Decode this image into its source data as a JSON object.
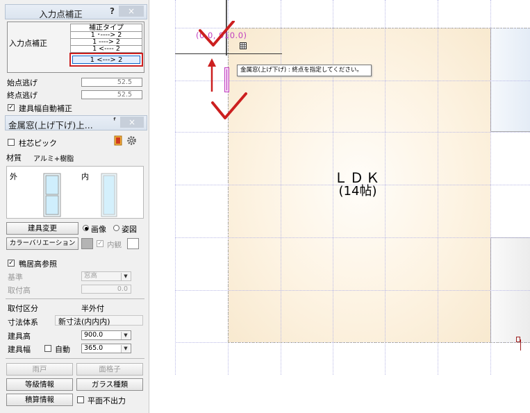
{
  "dialog_correction": {
    "title": "入力点補正",
    "help": "?",
    "close": "×",
    "table_header": "補正タイプ",
    "row_label": "入力点補正",
    "options": [
      "1 ･----> 2",
      "1 ----> 2",
      "1 <---- 2",
      "1 <---> 2"
    ],
    "start_offset_label": "始点逃げ",
    "start_offset_value": "52.5",
    "end_offset_label": "終点逃げ",
    "end_offset_value": "52.5",
    "auto_width_label": "建具幅自動補正",
    "auto_width_checked": true
  },
  "dialog_window": {
    "title": "金属窓(上げ下げ)上...",
    "pillar_pick_label": "柱芯ピック",
    "material_label": "材質",
    "material_value": "アルミ+樹脂",
    "outer_label": "外",
    "inner_label": "内",
    "change_fitting_button": "建具変更",
    "radio_image": "画像",
    "radio_figure": "姿図",
    "color_variation_button": "カラーバリエーション",
    "interior_view_label": "内観",
    "lintel_ref_label": "鴨居高参照",
    "base_label": "基準",
    "base_value": "窓高",
    "mount_height_label": "取付高",
    "mount_height_value": "0.0",
    "mount_type_label": "取付区分",
    "mount_type_value": "半外付",
    "dimension_system_label": "寸法体系",
    "dimension_system_value": "新寸法(内内内)",
    "fitting_height_label": "建具高",
    "fitting_height_value": "900.0",
    "fitting_width_label": "建具幅",
    "auto_label": "自動",
    "fitting_width_value": "365.0",
    "shutter_button": "雨戸",
    "grille_button": "面格子",
    "grade_info_button": "等級情報",
    "glass_type_button": "ガラス種類",
    "estimate_info_button": "積算情報",
    "no_plan_output_label": "平面不出力"
  },
  "canvas": {
    "coordinate_readout": "(0.0, 910.0)",
    "tooltip": "金属窓(上げ下げ) : 終点を指定してください。",
    "room_name": "ＬＤＫ",
    "room_size": "(14帖)"
  },
  "colors": {
    "highlight_frame": "#cc1f1f",
    "selected_option": "#0a64c8",
    "annotation_arrow": "#cc1f1f",
    "coordinate_text": "#c040c0",
    "room_fill": "#fdf3e2"
  }
}
